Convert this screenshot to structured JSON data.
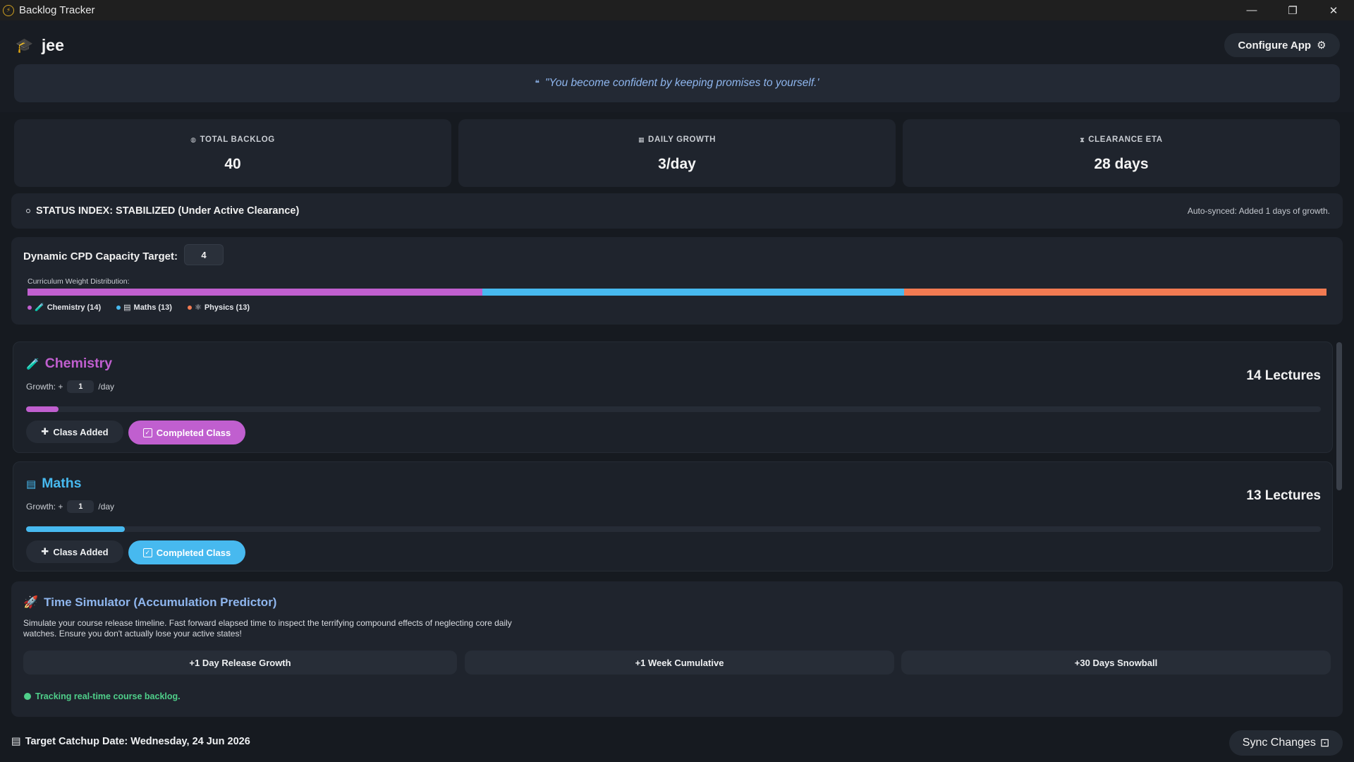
{
  "window": {
    "title": "Backlog Tracker"
  },
  "header": {
    "profile_name": "jee",
    "configure_label": "Configure App",
    "quote": "\"You become confident by keeping promises to yourself.'"
  },
  "stats": {
    "total_backlog_label": "TOTAL BACKLOG",
    "total_backlog_value": "40",
    "daily_growth_label": "DAILY GROWTH",
    "daily_growth_value": "3/day",
    "clearance_eta_label": "CLEARANCE ETA",
    "clearance_eta_value": "28 days"
  },
  "status": {
    "text": "STATUS INDEX: STABILIZED (Under Active Clearance)",
    "sync_text": "Auto-synced: Added 1 days of growth."
  },
  "capacity": {
    "label": "Dynamic CPD Capacity Target:",
    "value": "4",
    "distribution_label": "Curriculum Weight Distribution:",
    "legend": [
      {
        "label": "Chemistry (14)",
        "color": "#c05fcf",
        "weight": 14
      },
      {
        "label": "Maths (13)",
        "color": "#47b9ef",
        "weight": 13
      },
      {
        "label": "Physics (13)",
        "color": "#f27b52",
        "weight": 13
      }
    ]
  },
  "subjects": [
    {
      "name": "Chemistry",
      "color": "#c05fcf",
      "icon": "flask-icon",
      "growth_prefix": "Growth: +",
      "growth_value": "1",
      "growth_suffix": "/day",
      "lectures": "14 Lectures",
      "progress": 0.025,
      "add_label": "Class Added",
      "complete_label": "Completed Class"
    },
    {
      "name": "Maths",
      "color": "#47b9ef",
      "icon": "calculator-icon",
      "growth_prefix": "Growth: +",
      "growth_value": "1",
      "growth_suffix": "/day",
      "lectures": "13 Lectures",
      "progress": 0.076,
      "add_label": "Class Added",
      "complete_label": "Completed Class"
    }
  ],
  "simulator": {
    "title": "Time Simulator (Accumulation Predictor)",
    "description": "Simulate your course release timeline. Fast forward elapsed time to inspect the terrifying compound effects of neglecting core daily watches. Ensure you don't actually lose your active states!",
    "btn_day": "+1 Day Release Growth",
    "btn_week": "+1 Week Cumulative",
    "btn_month": "+30 Days Snowball",
    "tracking": "Tracking real-time course backlog."
  },
  "footer": {
    "target_date": "Target Catchup Date: Wednesday, 24 Jun 2026",
    "sync_label": "Sync Changes"
  }
}
